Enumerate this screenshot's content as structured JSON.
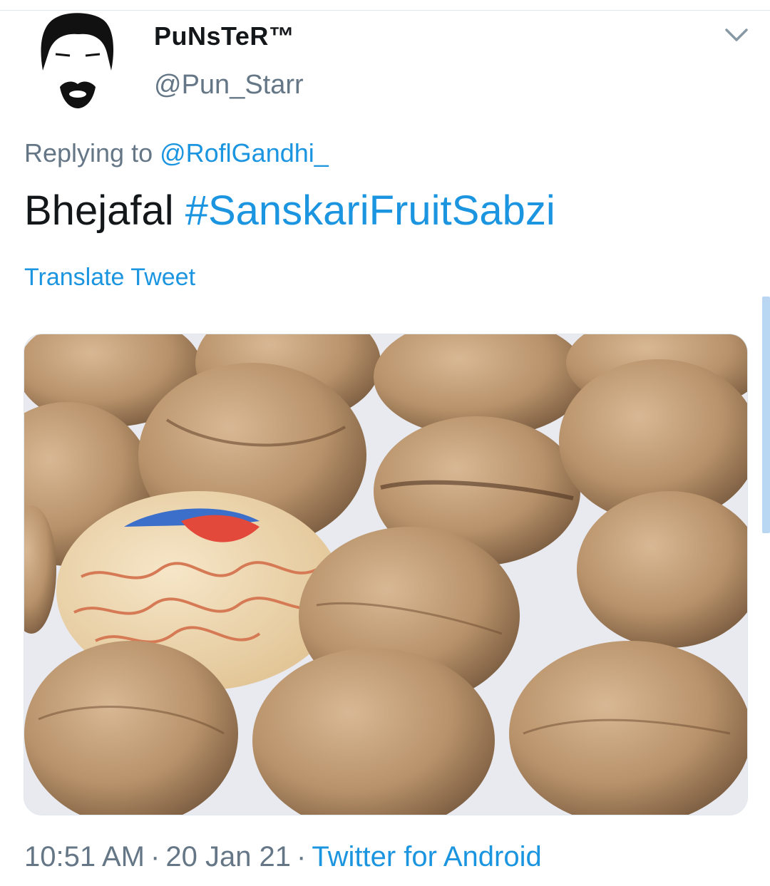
{
  "tweet": {
    "display_name": "PuNsTeR™",
    "handle": "@Pun_Starr",
    "replying_prefix": "Replying to ",
    "replying_to": "@RoflGandhi_",
    "text_plain": "Bhejafal ",
    "hashtag": "#SanskariFruitSabzi",
    "translate_label": "Translate Tweet",
    "time": "10:51 AM",
    "separator": "·",
    "date": "20 Jan 21",
    "source": "Twitter for Android"
  },
  "icons": {
    "caret": "chevron-down-icon",
    "avatar": "mustache-face-avatar"
  },
  "colors": {
    "link": "#1b95e0",
    "secondary_text": "#657786",
    "primary_text": "#14171a"
  }
}
